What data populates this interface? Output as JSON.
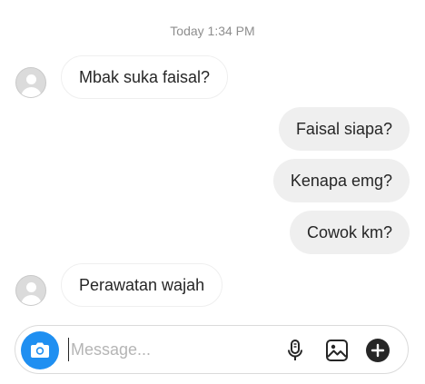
{
  "timestamp": "Today 1:34 PM",
  "messages": [
    {
      "direction": "incoming",
      "text": "Mbak suka faisal?"
    },
    {
      "direction": "outgoing",
      "text": "Faisal siapa?"
    },
    {
      "direction": "outgoing",
      "text": "Kenapa emg?"
    },
    {
      "direction": "outgoing",
      "text": "Cowok km?"
    },
    {
      "direction": "incoming",
      "text": "Perawatan wajah"
    }
  ],
  "composer": {
    "placeholder": "Message...",
    "value": ""
  },
  "icons": {
    "camera": "camera-icon",
    "microphone": "microphone-icon",
    "gallery": "gallery-icon",
    "add": "plus-circle-icon"
  },
  "colors": {
    "accent": "#1f8ff1",
    "outgoing_bubble": "#efefef",
    "timestamp_text": "#8e8e8e"
  }
}
